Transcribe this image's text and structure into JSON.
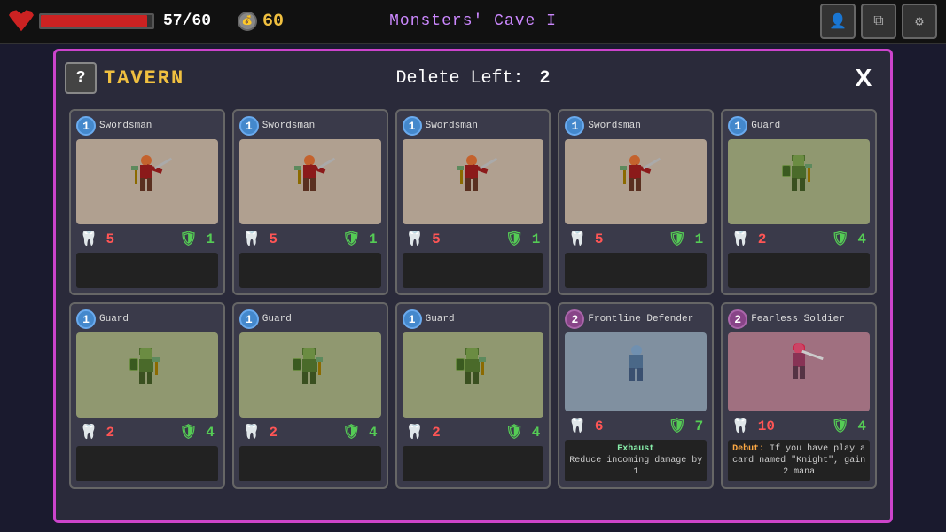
{
  "topBar": {
    "health": {
      "current": 57,
      "max": 60,
      "pct": 95,
      "label": "57/60"
    },
    "gold": {
      "amount": 60,
      "label": "60"
    },
    "title": "Monsters' Cave I",
    "icons": [
      {
        "name": "character-icon",
        "symbol": "👤"
      },
      {
        "name": "layers-icon",
        "symbol": "⧉"
      },
      {
        "name": "settings-icon",
        "symbol": "⚙"
      }
    ]
  },
  "panel": {
    "questionMark": "?",
    "tavernLabel": "TAVERN",
    "deleteLeft": "Delete Left:",
    "deleteCount": "2",
    "closeLabel": "X",
    "cards": [
      {
        "id": 1,
        "cost": 1,
        "costClass": "cost-1",
        "name": "Swordsman",
        "type": "swordsman",
        "attack": 5,
        "defense": 1,
        "hasDesc": false
      },
      {
        "id": 2,
        "cost": 1,
        "costClass": "cost-1",
        "name": "Swordsman",
        "type": "swordsman",
        "attack": 5,
        "defense": 1,
        "hasDesc": false
      },
      {
        "id": 3,
        "cost": 1,
        "costClass": "cost-1",
        "name": "Swordsman",
        "type": "swordsman",
        "attack": 5,
        "defense": 1,
        "hasDesc": false
      },
      {
        "id": 4,
        "cost": 1,
        "costClass": "cost-1",
        "name": "Swordsman",
        "type": "swordsman",
        "attack": 5,
        "defense": 1,
        "hasDesc": false
      },
      {
        "id": 5,
        "cost": 1,
        "costClass": "cost-1",
        "name": "Guard",
        "type": "guard",
        "attack": 2,
        "defense": 4,
        "hasDesc": false
      },
      {
        "id": 6,
        "cost": 1,
        "costClass": "cost-1",
        "name": "Guard",
        "type": "guard",
        "attack": 2,
        "defense": 4,
        "hasDesc": false
      },
      {
        "id": 7,
        "cost": 1,
        "costClass": "cost-1",
        "name": "Guard",
        "type": "guard",
        "attack": 2,
        "defense": 4,
        "hasDesc": false
      },
      {
        "id": 8,
        "cost": 1,
        "costClass": "cost-1",
        "name": "Guard",
        "type": "guard",
        "attack": 2,
        "defense": 4,
        "hasDesc": false
      },
      {
        "id": 9,
        "cost": 2,
        "costClass": "cost-2",
        "name": "Frontline Defender",
        "type": "frontline",
        "attack": 6,
        "defense": 7,
        "hasDesc": true,
        "keyword": "Exhaust",
        "keywordColor": "exhaust",
        "desc": "Reduce incoming damage by 1"
      },
      {
        "id": 10,
        "cost": 2,
        "costClass": "cost-2",
        "name": "Fearless Soldier",
        "type": "fearless",
        "attack": 10,
        "defense": 4,
        "hasDesc": true,
        "keyword": "Debut:",
        "keywordColor": "debut",
        "desc": "If you have play a card named \"Knight\", gain 2 mana"
      }
    ]
  }
}
